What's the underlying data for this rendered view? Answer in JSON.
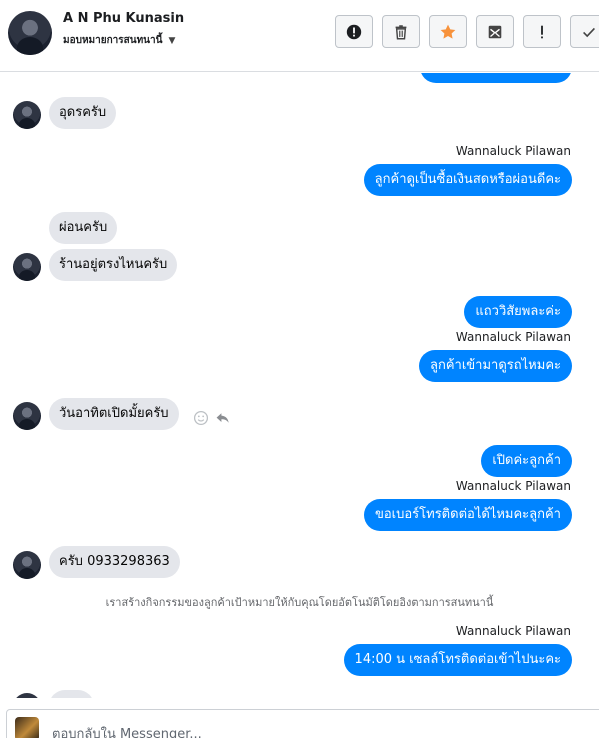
{
  "header": {
    "contact_name": "A N Phu Kunasin",
    "assign_label": "มอบหมายการสนทนานี้",
    "tools": [
      {
        "name": "spam",
        "icon": "alert-circle-icon"
      },
      {
        "name": "delete",
        "icon": "trash-icon"
      },
      {
        "name": "follow-up",
        "icon": "star-icon"
      },
      {
        "name": "mark-unread",
        "icon": "mail-icon"
      },
      {
        "name": "important",
        "icon": "exclamation-icon"
      },
      {
        "name": "done",
        "icon": "check-icon"
      }
    ],
    "star_color": "#f7923b"
  },
  "colors": {
    "outgoing_bubble": "#0084ff",
    "incoming_bubble": "#e4e6eb"
  },
  "messages": {
    "m1": "อุดรครับ",
    "sender1": "Wannaluck Pilawan",
    "m2": "ลูกค้าดูเป็นซื้อเงินสดหรือผ่อนดีคะ",
    "m3": "ผ่อนครับ",
    "m4": "ร้านอยู่ตรงไหนครับ",
    "m5": "แถววิสัยพละค่ะ",
    "sender2": "Wannaluck Pilawan",
    "m6": "ลูกค้าเข้ามาดูรถไหมคะ",
    "m7": "วันอาทิตเปิดมั้ยครับ",
    "m8": "เปิดค่ะลูกค้า",
    "sender3": "Wannaluck Pilawan",
    "m9": "ขอเบอร์โทรติดต่อได้ไหมคะลูกค้า",
    "m10": "ครับ 0933298363",
    "system_note": "เราสร้างกิจกรรมของลูกค้าเป้าหมายให้กับคุณโดยอัตโนมัติโดยอิงตามการสนทนานี้",
    "sender4": "Wannaluck Pilawan",
    "m11": "14:00 น เซลล์โทรติดต่อเข้าไปนะคะ"
  },
  "composer": {
    "placeholder": "ตอบกลับใน Messenger..."
  }
}
